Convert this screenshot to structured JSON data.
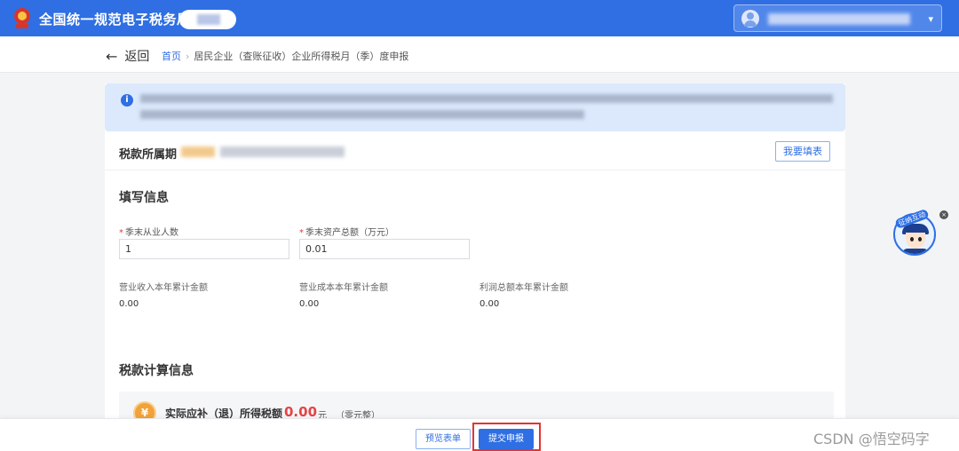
{
  "header": {
    "site_title": "全国统一规范电子税务局",
    "user_caret": "▾"
  },
  "breadcrumb": {
    "back_label": "返回",
    "back_arrow": "←",
    "home": "首页",
    "separator": "›",
    "current": "居民企业（查账征收）企业所得税月（季）度申报"
  },
  "notice": {
    "icon": "i"
  },
  "period": {
    "label": "税款所属期",
    "fill_button": "我要填表"
  },
  "fill_info": {
    "title": "填写信息",
    "required_mark": "*",
    "employees_label": "季末从业人数",
    "employees_value": "1",
    "assets_label": "季末资产总额（万元）",
    "assets_value": "0.01",
    "revenue_label": "营业收入本年累计金额",
    "revenue_value": "0.00",
    "cost_label": "营业成本本年累计金额",
    "cost_value": "0.00",
    "profit_label": "利润总额本年累计金额",
    "profit_value": "0.00"
  },
  "tax_calc": {
    "title": "税款计算信息",
    "coin_icon": "¥",
    "amount_label": "实际应补（退）所得税额",
    "amount_value": "0.00",
    "unit": "元",
    "amount_words": "（零元整）"
  },
  "footer": {
    "preview_button": "预览表单",
    "submit_button": "提交申报"
  },
  "mascot": {
    "label": "征纳互动",
    "close": "×"
  },
  "watermark": "CSDN @悟空码字",
  "colors": {
    "primary": "#2f6fe3",
    "highlight_outline": "#e23434",
    "amount_red": "#e84343",
    "notice_bg": "#dce9fc"
  }
}
